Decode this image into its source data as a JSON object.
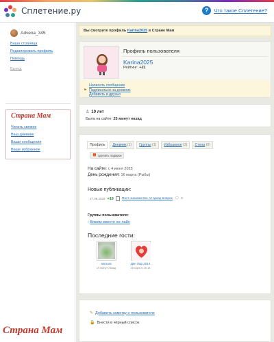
{
  "brand": {
    "name": "Сплетение.ру",
    "help": "Что такое Сплетение?"
  },
  "sidebar": {
    "user": "Advena_345",
    "links": [
      "Ваша страница",
      "Редактировать профиль",
      "Помощь"
    ],
    "logout": "Выход",
    "strana_mam": {
      "title": "Страна Мам",
      "links": [
        "Читать свежее",
        "Ваш дневник",
        "Ваши сообщения",
        "Ваше избранное"
      ]
    }
  },
  "banner": {
    "prefix": "Вы смотрите профиль",
    "user": "Karina2025",
    "suffix": "в Стране Мам"
  },
  "profile": {
    "header": "Профиль пользователя",
    "name": "Karina2025",
    "rating_label": "Рейтинг:",
    "rating_value": "+21",
    "actions": [
      "Написать сообщение",
      "Подписаться на дневник",
      "Добавить в друзья"
    ]
  },
  "meta": {
    "age": "10 лет",
    "last_seen_label": "Была на сайте:",
    "last_seen_value": "25 минут назад"
  },
  "tabs": [
    {
      "label": "Профиль",
      "count": ""
    },
    {
      "label": "Дневник",
      "count": "(1)"
    },
    {
      "label": "Группы",
      "count": "(1)"
    },
    {
      "label": "Избранное",
      "count": "(3)"
    },
    {
      "label": "Стена",
      "count": "(0)"
    }
  ],
  "gift_button": "сделать подарок",
  "details": {
    "on_site_label": "На сайте:",
    "on_site_value": "с 4 июня 2025",
    "birthday_label": "День рождения:",
    "birthday_value": "16 марта (Рыбы)"
  },
  "publications": {
    "title": "Новые публикации:",
    "items": [
      {
        "date": "27.06.2025",
        "score": "+19",
        "title": "Пост-знакомство. И сразу вопрос",
        "comments": "9"
      }
    ]
  },
  "groups": {
    "title": "Группы пользователя:",
    "items": [
      "Вяжем вместе он-лайн"
    ]
  },
  "guests": {
    "title": "Последние гости:",
    "items": [
      {
        "name": "anmura",
        "time": "19 минут назад"
      },
      {
        "name": "Ден Лар 2014",
        "time": "сегодня в 18:18"
      }
    ]
  },
  "bottom": {
    "add_note": "Добавить заметку о пользователе",
    "blacklist": "Внести в чёрный список"
  },
  "watermark": "Страна Мам",
  "colors": {
    "link": "#2a6fb5",
    "accent_red": "#c0392b",
    "banner_bg": "#fbf6dc",
    "content_bg": "#e9e9e4"
  }
}
